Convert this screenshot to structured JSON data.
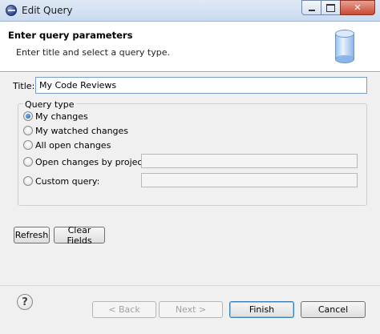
{
  "window": {
    "title": "Edit Query"
  },
  "header": {
    "title": "Enter query parameters",
    "subtitle": "Enter title and select a query type."
  },
  "form": {
    "title_label": "Title:",
    "title_value": "My Code Reviews",
    "query_type_label": "Query type",
    "options": [
      {
        "label": "My changes",
        "checked": true
      },
      {
        "label": "My watched changes",
        "checked": false
      },
      {
        "label": "All open changes",
        "checked": false
      },
      {
        "label": "Open changes by project:",
        "checked": false
      },
      {
        "label": "Custom query:",
        "checked": false
      }
    ],
    "project_field": "",
    "custom_query_field": ""
  },
  "actions": {
    "refresh": "Refresh",
    "clear_fields": "Clear Fields"
  },
  "footer": {
    "help_icon": "?",
    "back": "< Back",
    "next": "Next >",
    "finish": "Finish",
    "cancel": "Cancel"
  }
}
